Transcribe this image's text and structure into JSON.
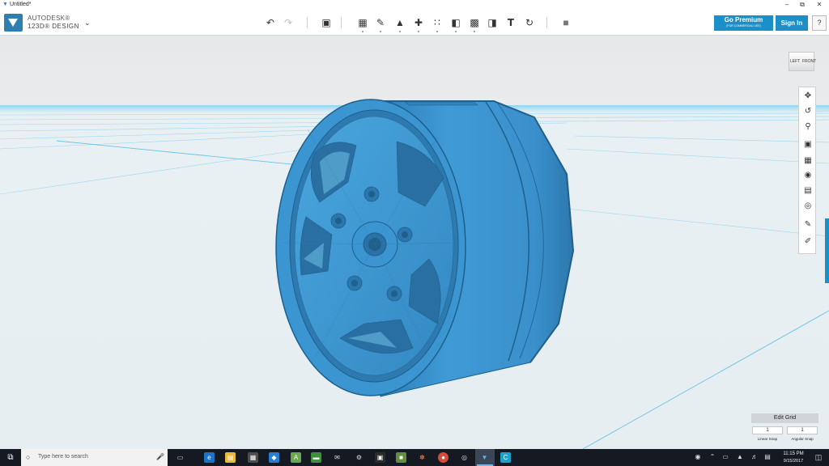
{
  "window": {
    "title": "Untitled*",
    "icon": "app-triangle-icon",
    "controls": [
      "minimize-icon",
      "maximize-icon",
      "close-icon"
    ]
  },
  "app": {
    "brand_line1": "AUTODESK®",
    "brand_line2": "123D® DESIGN",
    "accent_color": "#1b8fc7"
  },
  "toolbar": {
    "history": [
      {
        "icon": "undo-icon",
        "enabled": true
      },
      {
        "icon": "redo-icon",
        "enabled": false
      }
    ],
    "tools": [
      "transform-icon",
      "primitives-icon",
      "sketch-icon",
      "construct-icon",
      "modify-icon",
      "pattern-icon",
      "grouping-icon",
      "combine-icon",
      "measure-icon",
      "text-tool-icon",
      "snap-icon",
      "material-icon"
    ],
    "go_premium": "Go Premium",
    "go_premium_sub": "(FOR COMMERCIAL USE)",
    "sign_in": "Sign In",
    "help": "?"
  },
  "viewcube": {
    "left": "LEFT",
    "front": "FRONT"
  },
  "navbar": {
    "buttons": [
      "pan-icon",
      "orbit-icon",
      "zoom-icon",
      "fit-icon",
      "views-icon",
      "visibility-icon",
      "materials-icon",
      "camera-icon",
      "edit-icon",
      "paint-icon"
    ]
  },
  "model": {
    "description": "wheel-rim",
    "color": "#3e9ad4"
  },
  "grid_panel": {
    "edit_grid": "Edit Grid",
    "linear_snap_value": "1",
    "angular_snap_value": "1",
    "linear_snap_label": "Linear Snap",
    "angular_snap_label": "Angular Snap"
  },
  "taskbar": {
    "search_placeholder": "Type here to search",
    "apps": [
      "task-view-icon",
      "edge-icon",
      "file-explorer-icon",
      "store-icon",
      "dropbox-icon",
      "android-studio-icon",
      "tablet-icon",
      "mail-icon",
      "steam-icon",
      "cinema-icon",
      "minecraft-icon",
      "app-icon",
      "chrome-icon",
      "app-circle-icon",
      "123d-design-icon",
      "cura-icon"
    ],
    "time": "11:15 PM",
    "date": "9/15/2017"
  }
}
